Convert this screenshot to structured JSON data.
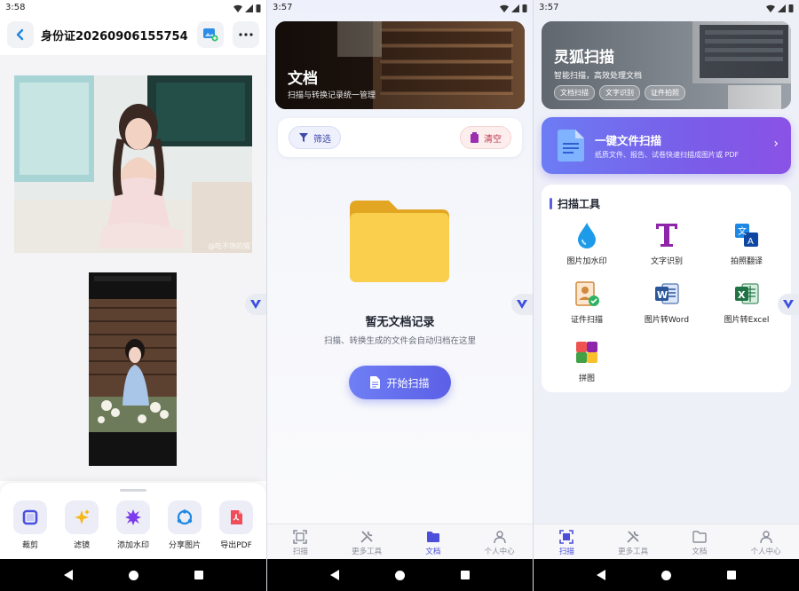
{
  "screen1": {
    "status_time": "3:58",
    "title": "身份证20260906155754",
    "watermark_text": "@吃不饱的猫",
    "tools": [
      {
        "label": "裁剪",
        "icon": "crop-icon"
      },
      {
        "label": "滤镜",
        "icon": "sparkle-filter-icon"
      },
      {
        "label": "添加水印",
        "icon": "watermark-burst-icon"
      },
      {
        "label": "分享图片",
        "icon": "share-icon"
      },
      {
        "label": "导出PDF",
        "icon": "pdf-icon"
      }
    ]
  },
  "screen2": {
    "status_time": "3:57",
    "hero_title": "文档",
    "hero_subtitle": "扫描与转换记录统一管理",
    "filter_label": "筛选",
    "clear_label": "清空",
    "empty_title": "暂无文档记录",
    "empty_desc": "扫描、转换生成的文件会自动归档在这里",
    "scan_button": "开始扫描",
    "active_tab": 2
  },
  "screen3": {
    "status_time": "3:57",
    "hero_title": "灵狐扫描",
    "hero_subtitle": "智能扫描，高效处理文档",
    "hero_tags": [
      "文档扫描",
      "文字识别",
      "证件拍照"
    ],
    "promo_title": "一键文件扫描",
    "promo_desc": "纸质文件、报告、试卷快速扫描成图片或 PDF",
    "tools_title": "扫描工具",
    "tools": [
      {
        "label": "图片加水印",
        "icon": "water-drop-icon"
      },
      {
        "label": "文字识别",
        "icon": "text-t-icon"
      },
      {
        "label": "拍照翻译",
        "icon": "translate-icon"
      },
      {
        "label": "证件扫描",
        "icon": "id-card-icon"
      },
      {
        "label": "图片转Word",
        "icon": "word-icon"
      },
      {
        "label": "图片转Excel",
        "icon": "excel-icon"
      },
      {
        "label": "拼图",
        "icon": "collage-icon"
      }
    ],
    "active_tab": 0
  },
  "tabs": [
    "扫描",
    "更多工具",
    "文档",
    "个人中心"
  ],
  "colors": {
    "accent": "#5b5fe6",
    "folder": "#f7c948",
    "danger": "#c2364a"
  }
}
